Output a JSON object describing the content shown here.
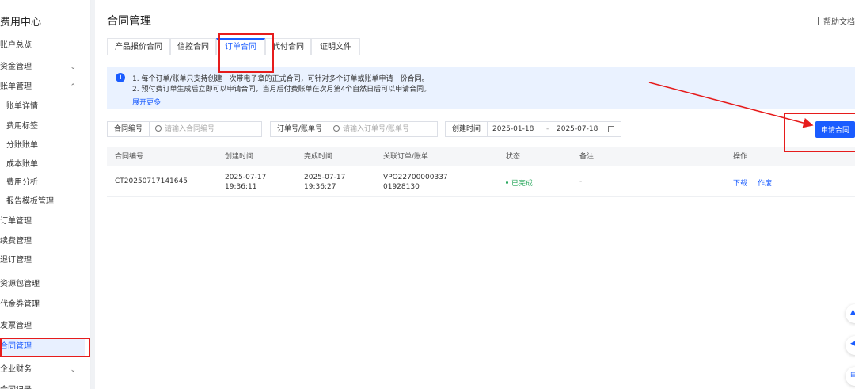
{
  "sidebar": {
    "title": "费用中心",
    "items": [
      {
        "label": "账户总览",
        "sub": false,
        "chevron": ""
      },
      {
        "label": "资金管理",
        "sub": false,
        "chevron": "⌄"
      },
      {
        "label": "账单管理",
        "sub": false,
        "chevron": "⌃"
      },
      {
        "label": "账单详情",
        "sub": true,
        "chevron": ""
      },
      {
        "label": "费用标签",
        "sub": true,
        "chevron": ""
      },
      {
        "label": "分账账单",
        "sub": true,
        "chevron": ""
      },
      {
        "label": "成本账单",
        "sub": true,
        "chevron": ""
      },
      {
        "label": "费用分析",
        "sub": true,
        "chevron": ""
      },
      {
        "label": "报告模板管理",
        "sub": true,
        "chevron": ""
      },
      {
        "label": "订单管理",
        "sub": false,
        "chevron": ""
      },
      {
        "label": "续费管理",
        "sub": false,
        "chevron": ""
      },
      {
        "label": "退订管理",
        "sub": false,
        "chevron": ""
      },
      {
        "label": "资源包管理",
        "sub": false,
        "chevron": ""
      },
      {
        "label": "代金券管理",
        "sub": false,
        "chevron": ""
      },
      {
        "label": "发票管理",
        "sub": false,
        "chevron": ""
      },
      {
        "label": "合同管理",
        "sub": false,
        "chevron": "",
        "active": true
      },
      {
        "label": "企业财务",
        "sub": false,
        "chevron": "⌄"
      },
      {
        "label": "合同记录",
        "sub": false,
        "chevron": ""
      }
    ]
  },
  "header": {
    "title": "合同管理",
    "help_label": "帮助文档"
  },
  "tabs": [
    {
      "label": "产品报价合同"
    },
    {
      "label": "信控合同"
    },
    {
      "label": "订单合同",
      "active": true
    },
    {
      "label": "代付合同"
    },
    {
      "label": "证明文件"
    }
  ],
  "notice": {
    "icon": "i",
    "line1": "1. 每个订单/账单只支持创建一次带电子章的正式合同，可针对多个订单或账单申请一份合同。",
    "line2": "2. 预付费订单生成后立即可以申请合同，当月后付费账单在次月第4个自然日后可以申请合同。",
    "expand_label": "展开更多"
  },
  "filters": {
    "contract_no_label": "合同编号",
    "contract_no_placeholder": "请输入合同编号",
    "order_label": "订单号/账单号",
    "order_placeholder": "请输入订单号/账单号",
    "date_label": "创建时间",
    "date_start": "2025-01-18",
    "date_sep": "-",
    "date_end": "2025-07-18"
  },
  "apply_button": "申请合同",
  "table": {
    "headers": [
      "合同编号",
      "创建时间",
      "完成时间",
      "关联订单/账单",
      "状态",
      "备注",
      "操作"
    ],
    "rows": [
      {
        "contract_no": "CT20250717141645",
        "created_date": "2025-07-17",
        "created_time": "19:36:11",
        "finished_date": "2025-07-17",
        "finished_time": "19:36:27",
        "related_1": "VPO22700000337",
        "related_2": "01928130",
        "status": "已完成",
        "remark": "-",
        "action_download": "下载",
        "action_void": "作废"
      }
    ]
  },
  "colors": {
    "primary": "#1a5cff",
    "annotation_red": "#e61c1c",
    "success": "#26a65b"
  }
}
